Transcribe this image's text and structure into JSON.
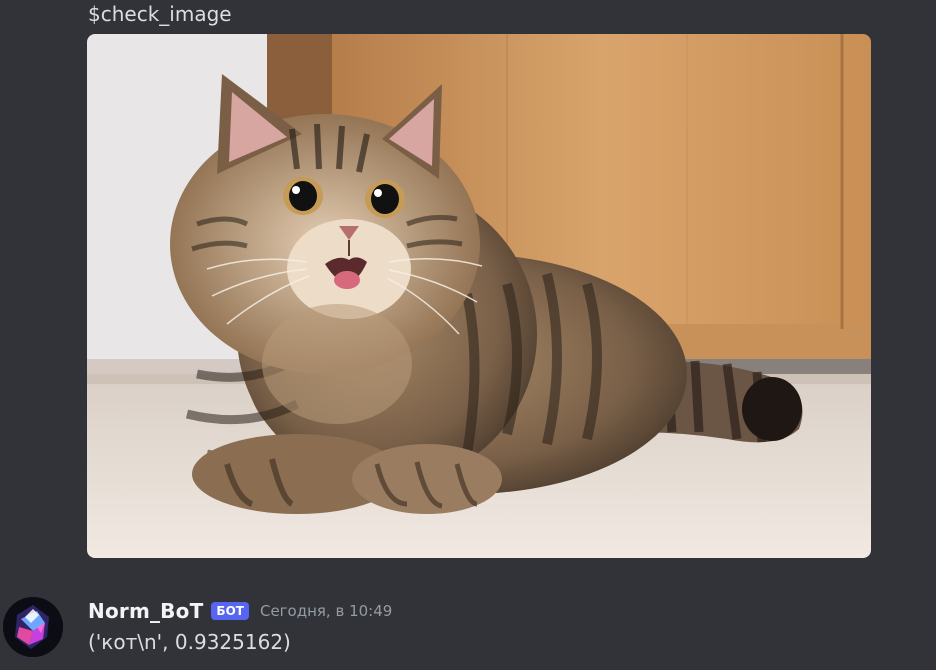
{
  "messages": {
    "command": {
      "text": "$check_image",
      "attachment": {
        "alt": "cat"
      }
    },
    "reply": {
      "username": "Norm_BoT",
      "bot_tag": "БОТ",
      "timestamp": "Сегодня, в 10:49",
      "content": "('кот\\n', 0.9325162)",
      "avatar_icon": "crystal-avatar-icon"
    }
  },
  "colors": {
    "background": "#313338",
    "text": "#dbdee1",
    "username": "#f2f3f5",
    "bot_tag_bg": "#5865f2",
    "timestamp": "#949ba4"
  }
}
